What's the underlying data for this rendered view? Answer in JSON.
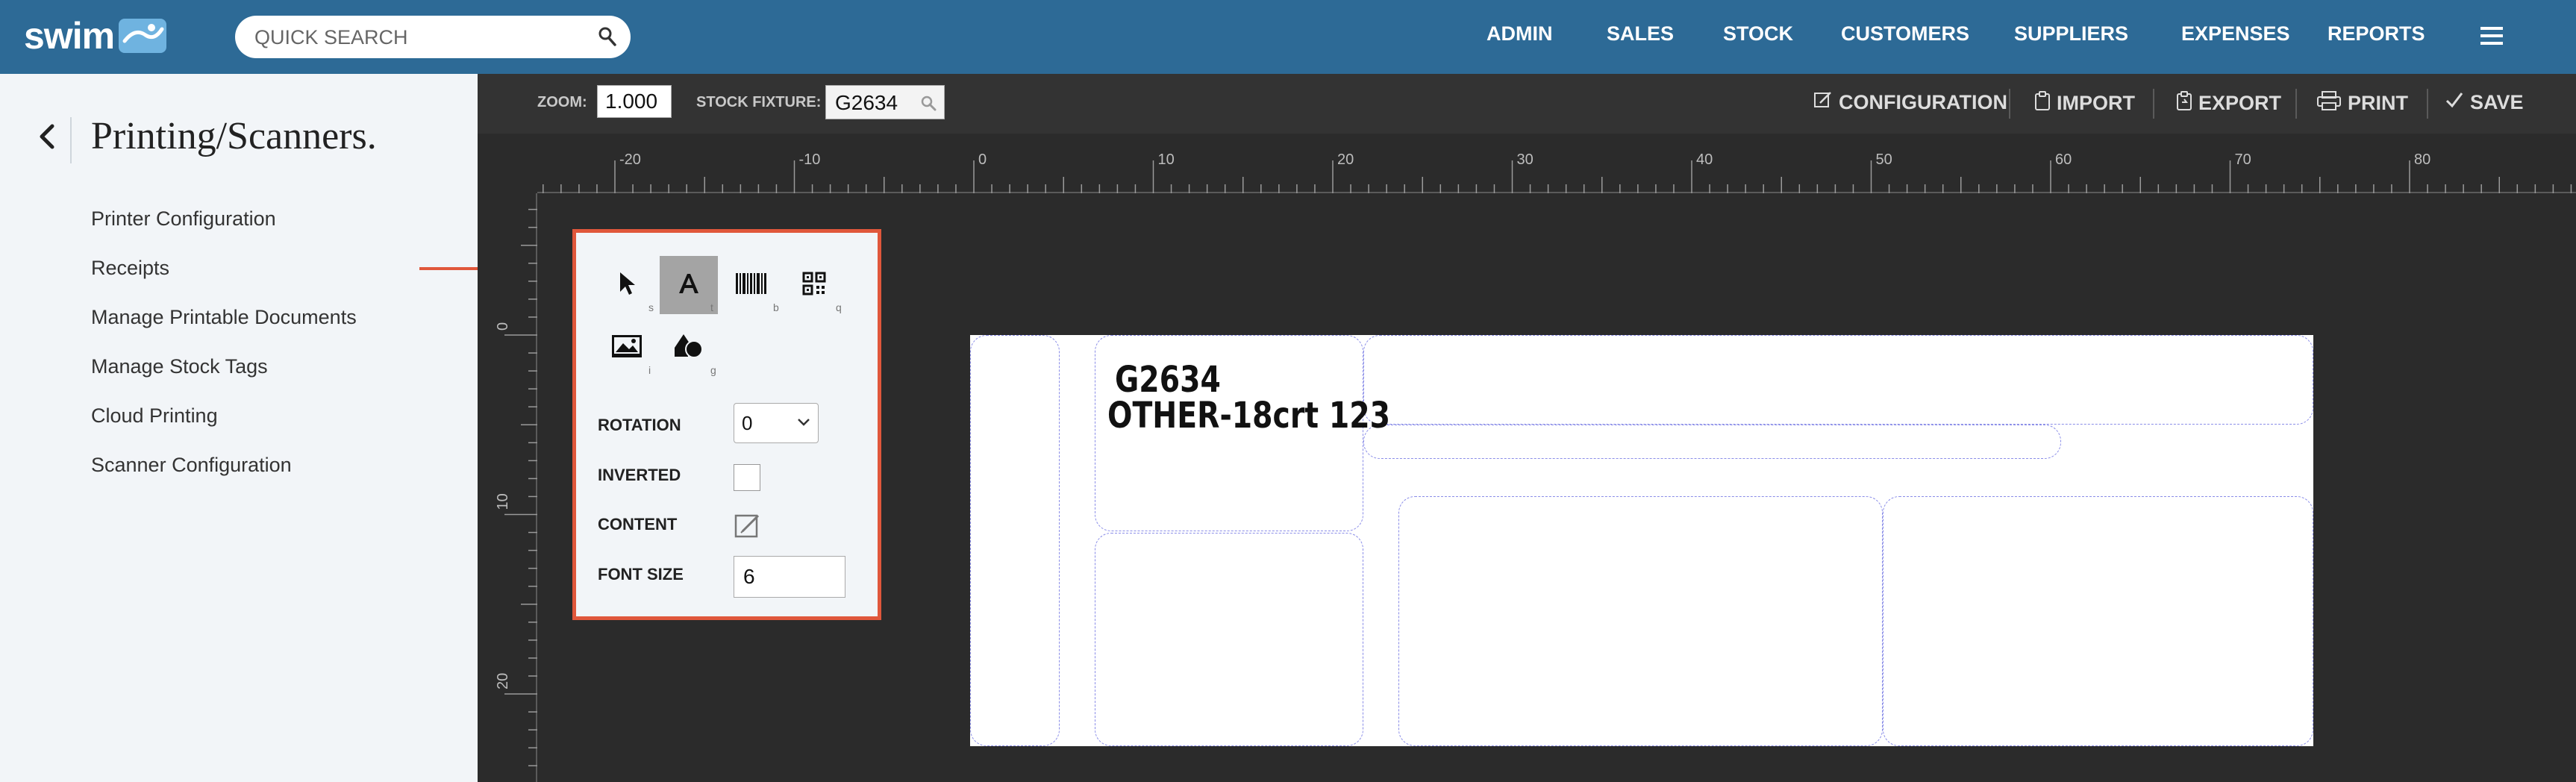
{
  "app": {
    "logo_text": "swim"
  },
  "search": {
    "placeholder": "QUICK SEARCH"
  },
  "nav": {
    "items": [
      "ADMIN",
      "SALES",
      "STOCK",
      "CUSTOMERS",
      "SUPPLIERS",
      "EXPENSES",
      "REPORTS"
    ]
  },
  "sidebar": {
    "title": "Printing/Scanners.",
    "items": [
      {
        "label": "Printer Configuration"
      },
      {
        "label": "Receipts"
      },
      {
        "label": "Manage Printable Documents"
      },
      {
        "label": "Manage Stock Tags"
      },
      {
        "label": "Cloud Printing"
      },
      {
        "label": "Scanner Configuration"
      }
    ]
  },
  "toolbar": {
    "zoom_label": "ZOOM:",
    "zoom_value": "1.000",
    "fixture_label": "STOCK FIXTURE:",
    "fixture_value": "G2634",
    "actions": {
      "configuration": "CONFIGURATION",
      "import": "IMPORT",
      "export": "EXPORT",
      "print": "PRINT",
      "save": "SAVE"
    }
  },
  "ruler": {
    "h_labels": [
      "-20",
      "-10",
      "0",
      "10",
      "20",
      "30",
      "40",
      "50",
      "60",
      "70",
      "80"
    ],
    "v_labels": [
      "0",
      "10",
      "20"
    ]
  },
  "tools": {
    "items": [
      {
        "name": "select",
        "key": "s",
        "active": false
      },
      {
        "name": "text",
        "key": "t",
        "active": true
      },
      {
        "name": "barcode",
        "key": "b",
        "active": false
      },
      {
        "name": "qrcode",
        "key": "q",
        "active": false
      },
      {
        "name": "image",
        "key": "i",
        "active": false
      },
      {
        "name": "shape",
        "key": "g",
        "active": false
      }
    ],
    "icons": [
      "cursor-icon",
      "text-icon",
      "barcode-icon",
      "qrcode-icon",
      "image-icon",
      "shapes-icon"
    ]
  },
  "properties": {
    "rotation_label": "ROTATION",
    "rotation_value": "0",
    "inverted_label": "INVERTED",
    "inverted_checked": false,
    "content_label": "CONTENT",
    "font_size_label": "FONT SIZE",
    "font_size_value": "6"
  },
  "label_preview": {
    "line1": "G2634",
    "line2": "OTHER-18crt 123"
  },
  "colors": {
    "header_bg": "#2d6a96",
    "sidebar_bg": "#f2f5f8",
    "canvas_bg": "#2b2b2b",
    "toolbar_bg": "#333333",
    "panel_highlight": "#e0573b",
    "zone_border": "#8a8de8"
  }
}
